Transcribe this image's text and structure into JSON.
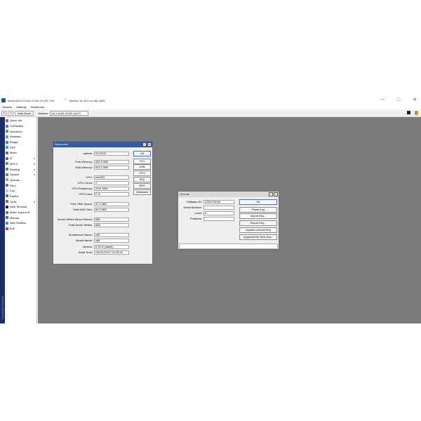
{
  "window": {
    "title": "admin@D4:CA:6D:29:6E:1A (RC Tel)",
    "title2": "WinBox v6.40.5 on x86 (x86)",
    "ctrl_min": "─",
    "ctrl_max": "□",
    "ctrl_close": "✕"
  },
  "menubar": {
    "items": [
      "Session",
      "Settings",
      "Dashboard"
    ]
  },
  "toolbar": {
    "undo": "↶",
    "redo": "↷",
    "safe_mode": "Safe Mode",
    "session_label": "Session:",
    "session_value": "D4:CA:6D:29:6E:1A:FC"
  },
  "sidebar": {
    "brand": "RouterOS WinBox",
    "items": [
      {
        "label": "Quick Set",
        "color": "#d24a3b",
        "arrow": ""
      },
      {
        "label": "CAPsMAN",
        "color": "#3b7ad2",
        "arrow": ""
      },
      {
        "label": "Interfaces",
        "color": "#3ba83b",
        "arrow": ""
      },
      {
        "label": "Wireless",
        "color": "#888888",
        "arrow": ""
      },
      {
        "label": "Bridge",
        "color": "#3b7ad2",
        "arrow": ""
      },
      {
        "label": "PPP",
        "color": "#3b9ad2",
        "arrow": ""
      },
      {
        "label": "Mesh",
        "color": "#6a6a6a",
        "arrow": ""
      },
      {
        "label": "IP",
        "color": "#4a6ab8",
        "arrow": "▸"
      },
      {
        "label": "MPLS",
        "color": "#7a7a7a",
        "arrow": "▸"
      },
      {
        "label": "Routing",
        "color": "#4a9a4a",
        "arrow": "▸"
      },
      {
        "label": "System",
        "color": "#7a7a7a",
        "arrow": "▸"
      },
      {
        "label": "Queues",
        "color": "#c0a030",
        "arrow": ""
      },
      {
        "label": "Files",
        "color": "#4a7ac8",
        "arrow": ""
      },
      {
        "label": "Log",
        "color": "#c8c8c8",
        "arrow": ""
      },
      {
        "label": "Radius",
        "color": "#3a8a3a",
        "arrow": ""
      },
      {
        "label": "Tools",
        "color": "#a05a2a",
        "arrow": "▸"
      },
      {
        "label": "New Terminal",
        "color": "#222222",
        "arrow": ""
      },
      {
        "label": "Make Supout.rif",
        "color": "#9a6a3a",
        "arrow": ""
      },
      {
        "label": "Manual",
        "color": "#3a6ac8",
        "arrow": ""
      },
      {
        "label": "New WinBox",
        "color": "#3a8ac8",
        "arrow": ""
      },
      {
        "label": "Exit",
        "color": "#c83a3a",
        "arrow": ""
      }
    ]
  },
  "resources": {
    "title": "Resources",
    "fields": [
      {
        "label": "Uptime:",
        "value": "00:00:52"
      },
      {
        "label": "Free Memory:",
        "value": "469.0 MiB"
      },
      {
        "label": "Total Memory:",
        "value": "503.2 MiB"
      },
      {
        "label": "CPU:",
        "value": "Intel(R)"
      },
      {
        "label": "CPU Count:",
        "value": "1"
      },
      {
        "label": "CPU Frequency:",
        "value": "2591 MHz"
      },
      {
        "label": "CPU Load:",
        "value": "0 %"
      },
      {
        "label": "Free HDD Space:",
        "value": "37.2 MiB"
      },
      {
        "label": "Total HDD Size:",
        "value": "56.9 MiB"
      },
      {
        "label": "Sector Writes Since Reboot:",
        "value": "688"
      },
      {
        "label": "Total Sector Writes:",
        "value": "688"
      },
      {
        "label": "Architecture Name:",
        "value": "x86"
      },
      {
        "label": "Board Name:",
        "value": "x86"
      },
      {
        "label": "Version:",
        "value": "6.40.5 (stable)"
      },
      {
        "label": "Build Time:",
        "value": "Oct/31/2017 13:05:15"
      }
    ],
    "buttons": [
      "OK",
      "PCI",
      "USB",
      "CPU",
      "IRQ",
      "RPS",
      "Hardware"
    ]
  },
  "license": {
    "title": "License",
    "fields": [
      {
        "label": "Software ID:",
        "value": "ZZ0H-E51W"
      },
      {
        "label": "Serial Number:",
        "value": ""
      },
      {
        "label": "Level:",
        "value": "6"
      },
      {
        "label": "Features:",
        "value": ""
      }
    ],
    "buttons": [
      "OK",
      "Paste Key",
      "Import Key...",
      "Export Key...",
      "Update License Key",
      "Upgrade/Get New Key..."
    ]
  }
}
